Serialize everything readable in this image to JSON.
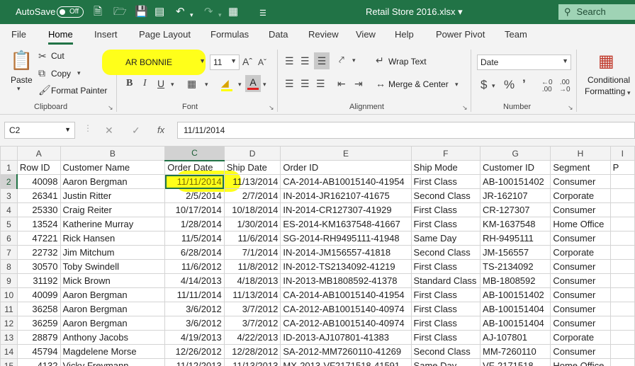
{
  "titlebar": {
    "autosave_label": "AutoSave",
    "autosave_state": "Off",
    "document_title": "Retail Store 2016.xlsx",
    "search_label": "Search"
  },
  "tabs": [
    "File",
    "Home",
    "Insert",
    "Page Layout",
    "Formulas",
    "Data",
    "Review",
    "View",
    "Help",
    "Power Pivot",
    "Team"
  ],
  "ribbon": {
    "clipboard": {
      "paste": "Paste",
      "cut": "Cut",
      "copy": "Copy",
      "format_painter": "Format Painter",
      "label": "Clipboard"
    },
    "font": {
      "font_name": "AR BONNIE",
      "font_size": "11",
      "label": "Font"
    },
    "alignment": {
      "wrap_text": "Wrap Text",
      "merge_center": "Merge & Center",
      "label": "Alignment"
    },
    "number": {
      "format": "Date",
      "label": "Number"
    },
    "styles": {
      "conditional_formatting_1": "Conditional",
      "conditional_formatting_2": "Formatting"
    }
  },
  "formula_bar": {
    "name_box": "C2",
    "formula": "11/11/2014",
    "fx": "fx"
  },
  "sheet": {
    "column_letters": [
      "A",
      "B",
      "C",
      "D",
      "E",
      "F",
      "G",
      "H",
      "I"
    ],
    "row_numbers": [
      "1",
      "2",
      "3",
      "4",
      "5",
      "6",
      "7",
      "8",
      "9",
      "10",
      "11",
      "12",
      "13",
      "14",
      "15"
    ],
    "header_row": [
      "Row ID",
      "Customer Name",
      "Order Date",
      "Ship Date",
      "Order ID",
      "Ship Mode",
      "Customer ID",
      "Segment",
      "P"
    ],
    "rows": [
      [
        "40098",
        "Aaron Bergman",
        "11/11/2014",
        "11/13/2014",
        "CA-2014-AB10015140-41954",
        "First Class",
        "AB-100151402",
        "Consumer"
      ],
      [
        "26341",
        "Justin Ritter",
        "2/5/2014",
        "2/7/2014",
        "IN-2014-JR162107-41675",
        "Second Class",
        "JR-162107",
        "Corporate"
      ],
      [
        "25330",
        "Craig Reiter",
        "10/17/2014",
        "10/18/2014",
        "IN-2014-CR127307-41929",
        "First Class",
        "CR-127307",
        "Consumer"
      ],
      [
        "13524",
        "Katherine Murray",
        "1/28/2014",
        "1/30/2014",
        "ES-2014-KM1637548-41667",
        "First Class",
        "KM-1637548",
        "Home Office"
      ],
      [
        "47221",
        "Rick Hansen",
        "11/5/2014",
        "11/6/2014",
        "SG-2014-RH9495111-41948",
        "Same Day",
        "RH-9495111",
        "Consumer"
      ],
      [
        "22732",
        "Jim Mitchum",
        "6/28/2014",
        "7/1/2014",
        "IN-2014-JM156557-41818",
        "Second Class",
        "JM-156557",
        "Corporate"
      ],
      [
        "30570",
        "Toby Swindell",
        "11/6/2012",
        "11/8/2012",
        "IN-2012-TS2134092-41219",
        "First Class",
        "TS-2134092",
        "Consumer"
      ],
      [
        "31192",
        "Mick Brown",
        "4/14/2013",
        "4/18/2013",
        "IN-2013-MB1808592-41378",
        "Standard Class",
        "MB-1808592",
        "Consumer"
      ],
      [
        "40099",
        "Aaron Bergman",
        "11/11/2014",
        "11/13/2014",
        "CA-2014-AB10015140-41954",
        "First Class",
        "AB-100151402",
        "Consumer"
      ],
      [
        "36258",
        "Aaron Bergman",
        "3/6/2012",
        "3/7/2012",
        "CA-2012-AB10015140-40974",
        "First Class",
        "AB-100151404",
        "Consumer"
      ],
      [
        "36259",
        "Aaron Bergman",
        "3/6/2012",
        "3/7/2012",
        "CA-2012-AB10015140-40974",
        "First Class",
        "AB-100151404",
        "Consumer"
      ],
      [
        "28879",
        "Anthony Jacobs",
        "4/19/2013",
        "4/22/2013",
        "ID-2013-AJ107801-41383",
        "First Class",
        "AJ-107801",
        "Corporate"
      ],
      [
        "45794",
        "Magdelene Morse",
        "12/26/2012",
        "12/28/2012",
        "SA-2012-MM7260110-41269",
        "Second Class",
        "MM-7260110",
        "Consumer"
      ],
      [
        "4132",
        "Vicky Freymann",
        "11/12/2013",
        "11/13/2013",
        "MX-2013-VF2171518-41591",
        "Same Day",
        "VF-2171518",
        "Home Office"
      ]
    ],
    "selected_cell": "C2"
  },
  "colors": {
    "brand_green": "#217346",
    "highlight_yellow": "#ffff1a"
  }
}
